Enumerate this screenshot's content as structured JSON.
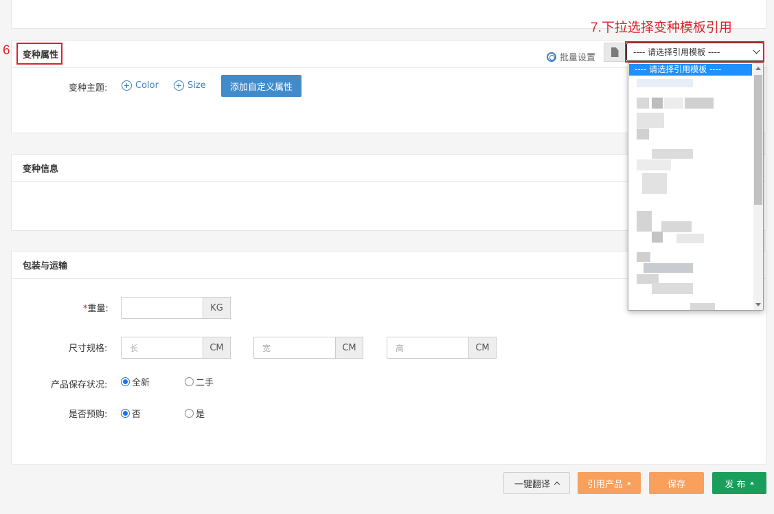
{
  "annotations": {
    "step6": "6.",
    "step7": "7.下拉选择变种模板引用",
    "color": "#d9232b"
  },
  "variant_attributes": {
    "title": "变种属性",
    "theme_label": "变种主题:",
    "themes": [
      "Color",
      "Size"
    ],
    "add_custom_label": "添加自定义属性",
    "batch_settings_label": "批量设置",
    "template_select": {
      "selected": "---- 请选择引用模板 ----",
      "options_first": "---- 请选择引用模板 ----"
    }
  },
  "variant_info": {
    "title": "变种信息"
  },
  "packaging": {
    "title": "包装与运输",
    "weight": {
      "required_mark": "*",
      "label": "重量:",
      "value": "",
      "unit": "KG"
    },
    "dimensions": {
      "label": "尺寸规格:",
      "fields": [
        {
          "placeholder": "长",
          "unit": "CM"
        },
        {
          "placeholder": "宽",
          "unit": "CM"
        },
        {
          "placeholder": "高",
          "unit": "CM"
        }
      ]
    },
    "condition": {
      "label": "产品保存状况:",
      "options": [
        "全新",
        "二手"
      ],
      "selected": "全新"
    },
    "preorder": {
      "label": "是否预购:",
      "options": [
        "否",
        "是"
      ],
      "selected": "否"
    }
  },
  "footer": {
    "translate_label": "一键翻译",
    "cite_label": "引用产品",
    "save_label": "保存",
    "publish_label": "发 布"
  },
  "colors": {
    "accent_blue": "#428bca",
    "orange": "#f8a05c",
    "green": "#1a9e5b",
    "dropdown_highlight": "#1e90ff"
  }
}
